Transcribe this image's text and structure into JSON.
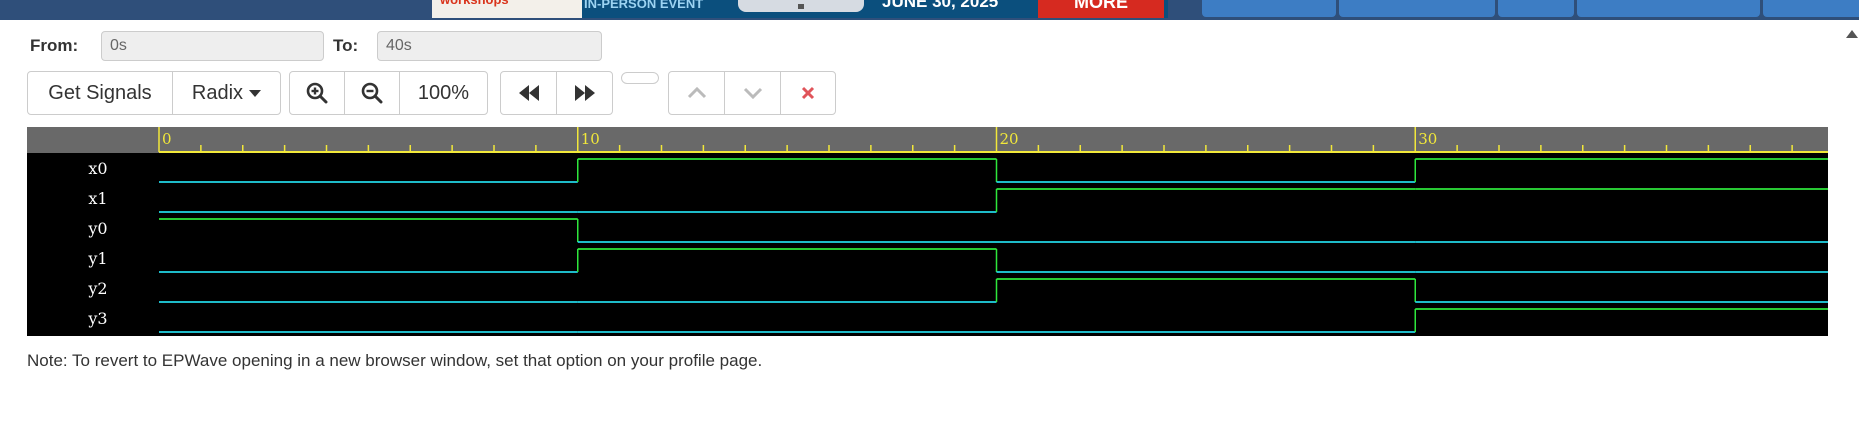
{
  "from": {
    "label": "From:",
    "value": "0s"
  },
  "to": {
    "label": "To:",
    "value": "40s"
  },
  "toolbar": {
    "get_signals": "Get Signals",
    "radix": "Radix",
    "zoom_level": "100%"
  },
  "waveform": {
    "ticks": [
      "0",
      "10",
      "20",
      "30"
    ],
    "signals": [
      {
        "name": "x0",
        "values": [
          0,
          1,
          0,
          1
        ]
      },
      {
        "name": "x1",
        "values": [
          0,
          0,
          1,
          1
        ]
      },
      {
        "name": "y0",
        "values": [
          1,
          0,
          0,
          0
        ]
      },
      {
        "name": "y1",
        "values": [
          0,
          1,
          0,
          0
        ]
      },
      {
        "name": "y2",
        "values": [
          0,
          0,
          1,
          0
        ]
      },
      {
        "name": "y3",
        "values": [
          0,
          0,
          0,
          1
        ]
      }
    ],
    "colors": {
      "low": "#22d6e6",
      "high": "#2ee63c",
      "axis": "#f2e83a",
      "ruler_bg": "#696969"
    }
  },
  "note": "Note: To revert to EPWave opening in a new browser window, set that option on your profile page."
}
